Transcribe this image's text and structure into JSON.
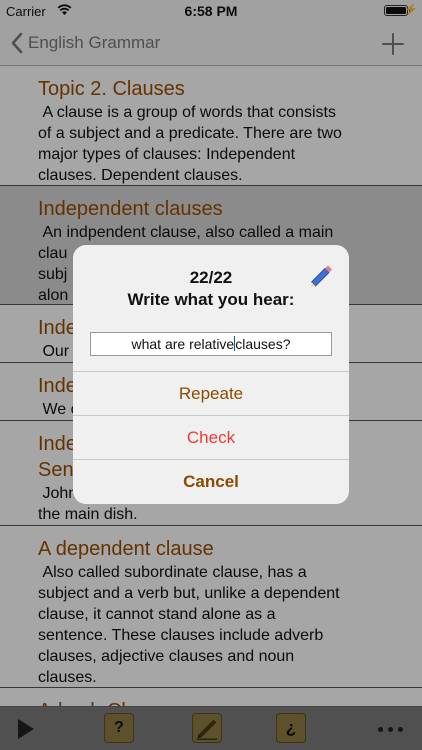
{
  "status_bar": {
    "carrier": "Carrier",
    "time": "6:58 PM"
  },
  "nav": {
    "back_label": "English Grammar",
    "back_icon": "chevron-left-icon",
    "add_icon": "plus-icon"
  },
  "cells": [
    {
      "title": "Topic 2. Clauses",
      "body": " A clause is a group of words that consists\nof a subject and a predicate. There are two\nmajor types of clauses: Independent\nclauses. Dependent clauses."
    },
    {
      "title": "Independent clauses",
      "body": " An indpendent clause, also called a main\nclau\nsubj\nalon"
    },
    {
      "title": "Inde",
      "body": " Our"
    },
    {
      "title": "Inde",
      "body": " We c"
    },
    {
      "title": "Inde\nSen",
      "body": " John\nthe main dish."
    },
    {
      "title": "A dependent clause",
      "body": " Also called subordinate clause, has a\nsubject and a verb but, unlike a dependent\nclause, it cannot stand alone as a\nsentence. These clauses include adverb\nclauses, adjective clauses and noun\nclauses."
    },
    {
      "title": "Adverb Cl",
      "body": ""
    }
  ],
  "tab_bar": {
    "question_label": "?",
    "inverted_question_label": "¿"
  },
  "alert": {
    "counter": "22/22",
    "message": "Write what you hear:",
    "answer_before_cursor": "what are relative",
    "answer_after_cursor": "clauses?",
    "repeat_label": "Repeate",
    "check_label": "Check",
    "cancel_label": "Cancel"
  },
  "colors": {
    "accent_brown": "#9a4e00",
    "destructive_red": "#ee3b31",
    "tab_icon_gold": "#8f7d43"
  }
}
